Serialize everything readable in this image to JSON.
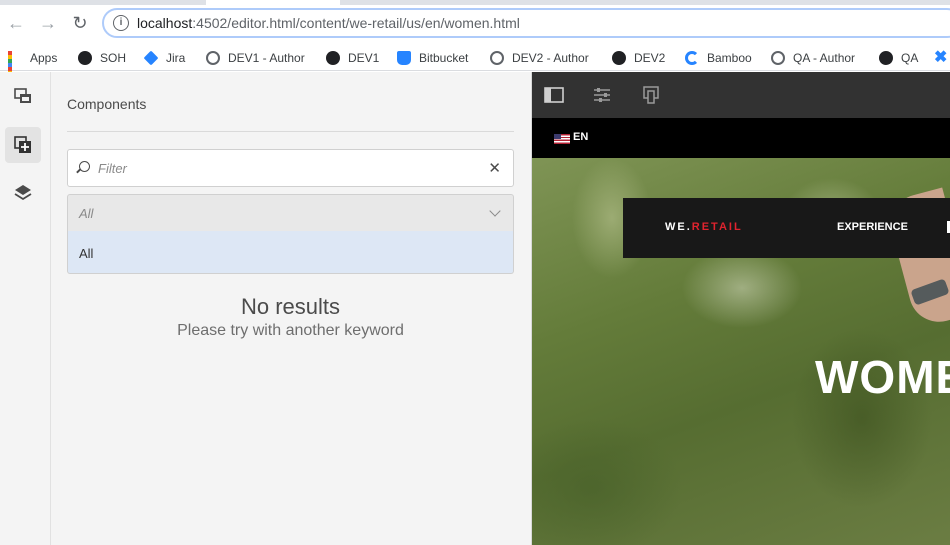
{
  "browser": {
    "url_host": "localhost",
    "url_rest": ":4502/editor.html/content/we-retail/us/en/women.html"
  },
  "bookmarks": [
    {
      "label": "Apps",
      "icon": "apps-grid-icon"
    },
    {
      "label": "SOH",
      "icon": "dark-logo-icon"
    },
    {
      "label": "Jira",
      "icon": "jira-icon"
    },
    {
      "label": "DEV1 - Author",
      "icon": "globe-icon"
    },
    {
      "label": "DEV1",
      "icon": "dark-logo-icon"
    },
    {
      "label": "Bitbucket",
      "icon": "bitbucket-icon"
    },
    {
      "label": "DEV2 - Author",
      "icon": "globe-icon"
    },
    {
      "label": "DEV2",
      "icon": "dark-logo-icon"
    },
    {
      "label": "Bamboo",
      "icon": "bamboo-icon"
    },
    {
      "label": "QA - Author",
      "icon": "globe-icon"
    },
    {
      "label": "QA",
      "icon": "dark-logo-icon"
    }
  ],
  "panel": {
    "title": "Components",
    "filter_placeholder": "Filter",
    "group_select_value": "All",
    "group_option": "All",
    "empty_title": "No results",
    "empty_subtitle": "Please try with another keyword"
  },
  "preview": {
    "language": "EN",
    "brand_prefix": "WE.",
    "brand_suffix": "RETAIL",
    "nav_item": "EXPERIENCE",
    "hero_title": "WOMEN"
  },
  "colors": {
    "brand_red": "#e0232e",
    "editor_toolbar": "#323232",
    "selected_option": "#dde7f5"
  }
}
